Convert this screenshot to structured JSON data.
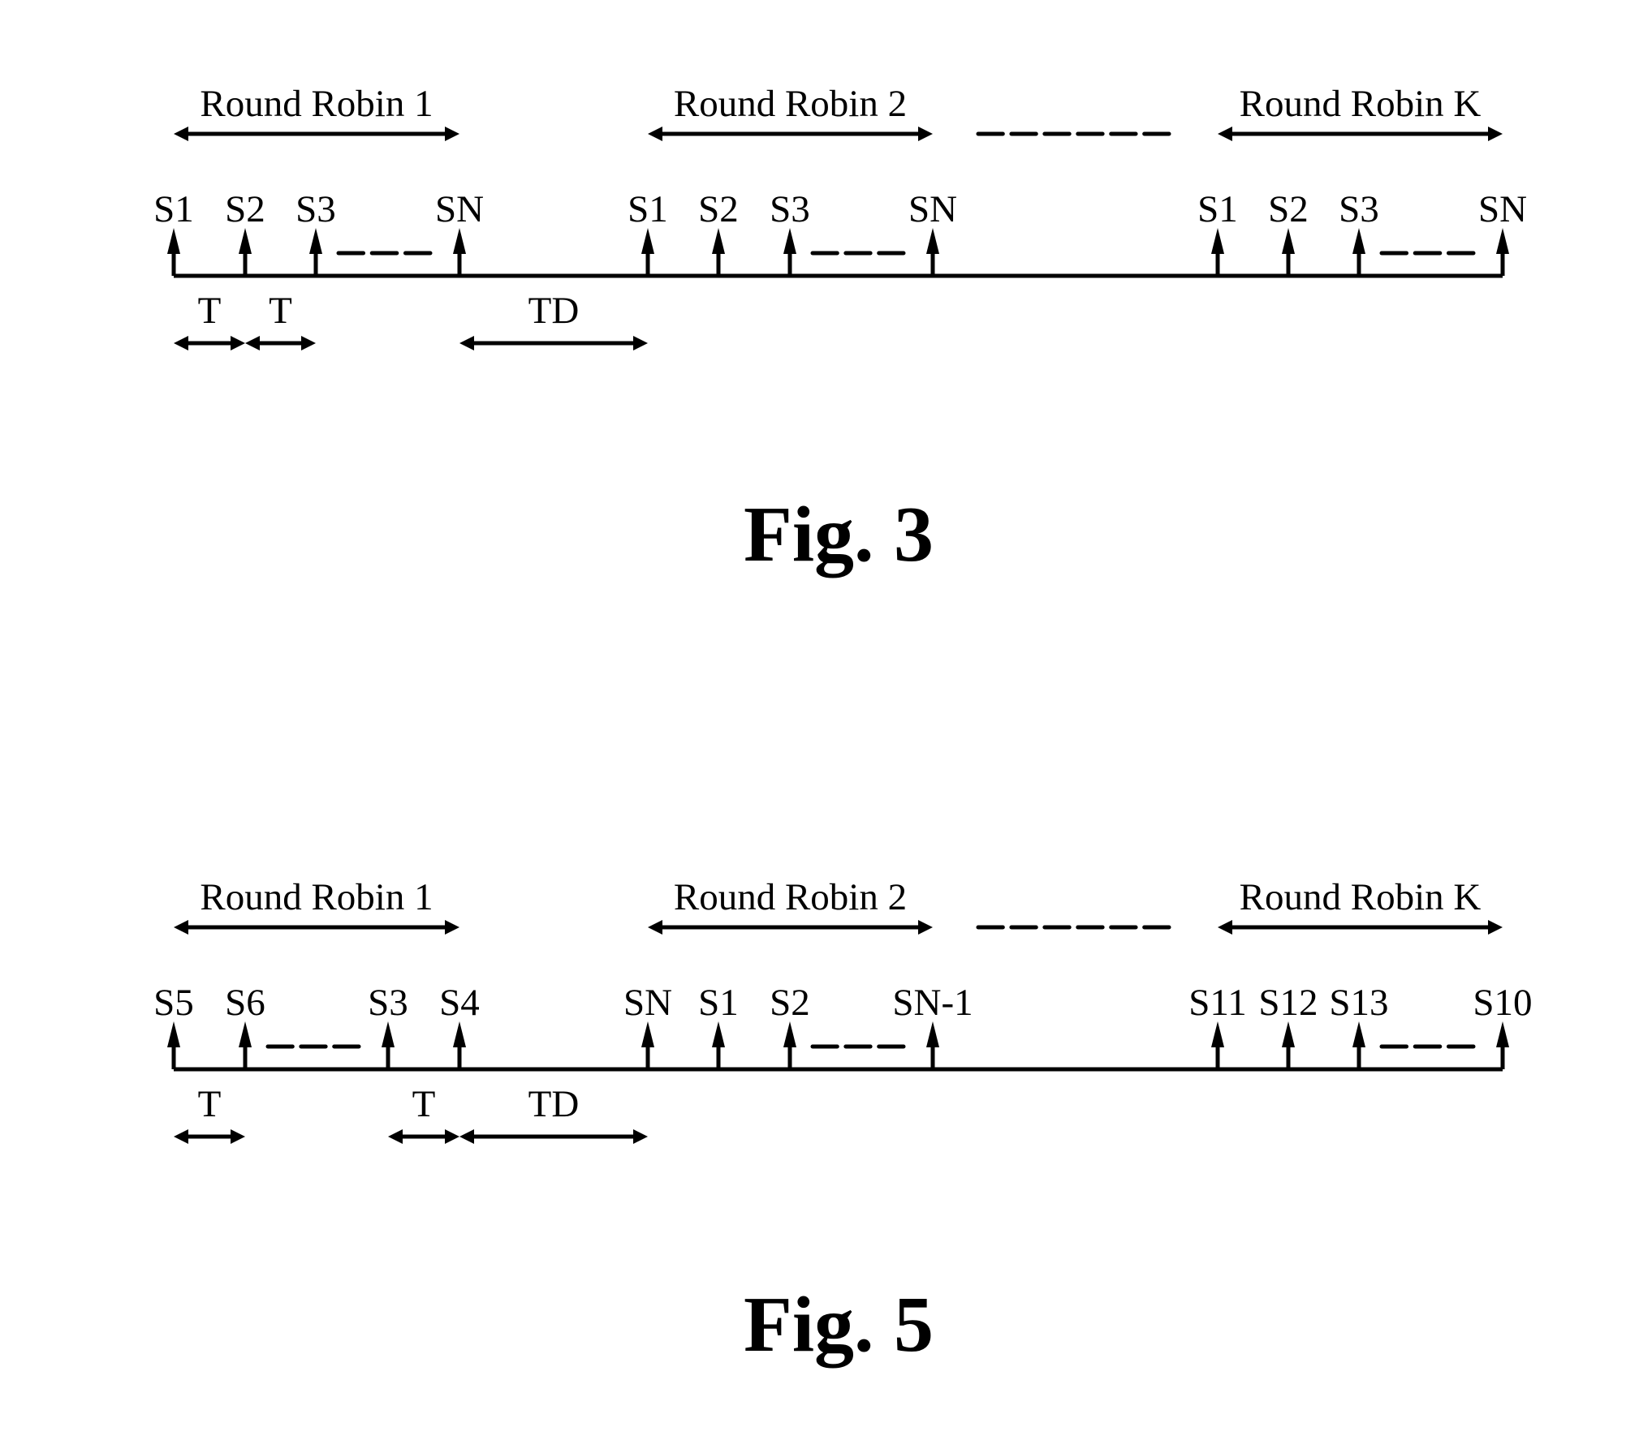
{
  "figures": [
    {
      "caption": "Fig. 3",
      "rounds": [
        {
          "label": "Round Robin 1",
          "slots": [
            "S1",
            "S2",
            "S3",
            "SN"
          ]
        },
        {
          "label": "Round Robin 2",
          "slots": [
            "S1",
            "S2",
            "S3",
            "SN"
          ]
        },
        {
          "label": "Round Robin K",
          "slots": [
            "S1",
            "S2",
            "S3",
            "SN"
          ]
        }
      ],
      "intervals": [
        {
          "label": "T",
          "from": "round0.slot0",
          "to": "round0.slot1"
        },
        {
          "label": "T",
          "from": "round0.slot1",
          "to": "round0.slot2"
        },
        {
          "label": "TD",
          "from": "round0.slot3",
          "to": "round1.slot0"
        }
      ]
    },
    {
      "caption": "Fig. 5",
      "rounds": [
        {
          "label": "Round Robin 1",
          "slots": [
            "S5",
            "S6",
            "S3",
            "S4"
          ],
          "gap_after_slot": 1
        },
        {
          "label": "Round Robin 2",
          "slots": [
            "SN",
            "S1",
            "S2",
            "SN-1"
          ],
          "gap_after_slot": 2
        },
        {
          "label": "Round Robin K",
          "slots": [
            "S11",
            "S12",
            "S13",
            "S10"
          ],
          "gap_after_slot": 2
        }
      ],
      "intervals": [
        {
          "label": "T",
          "from": "round0.slot0",
          "to": "round0.slot1"
        },
        {
          "label": "T",
          "from": "round0.slot2",
          "to": "round0.slot3"
        },
        {
          "label": "TD",
          "from": "round0.slot3",
          "to": "round1.slot0"
        }
      ]
    }
  ]
}
